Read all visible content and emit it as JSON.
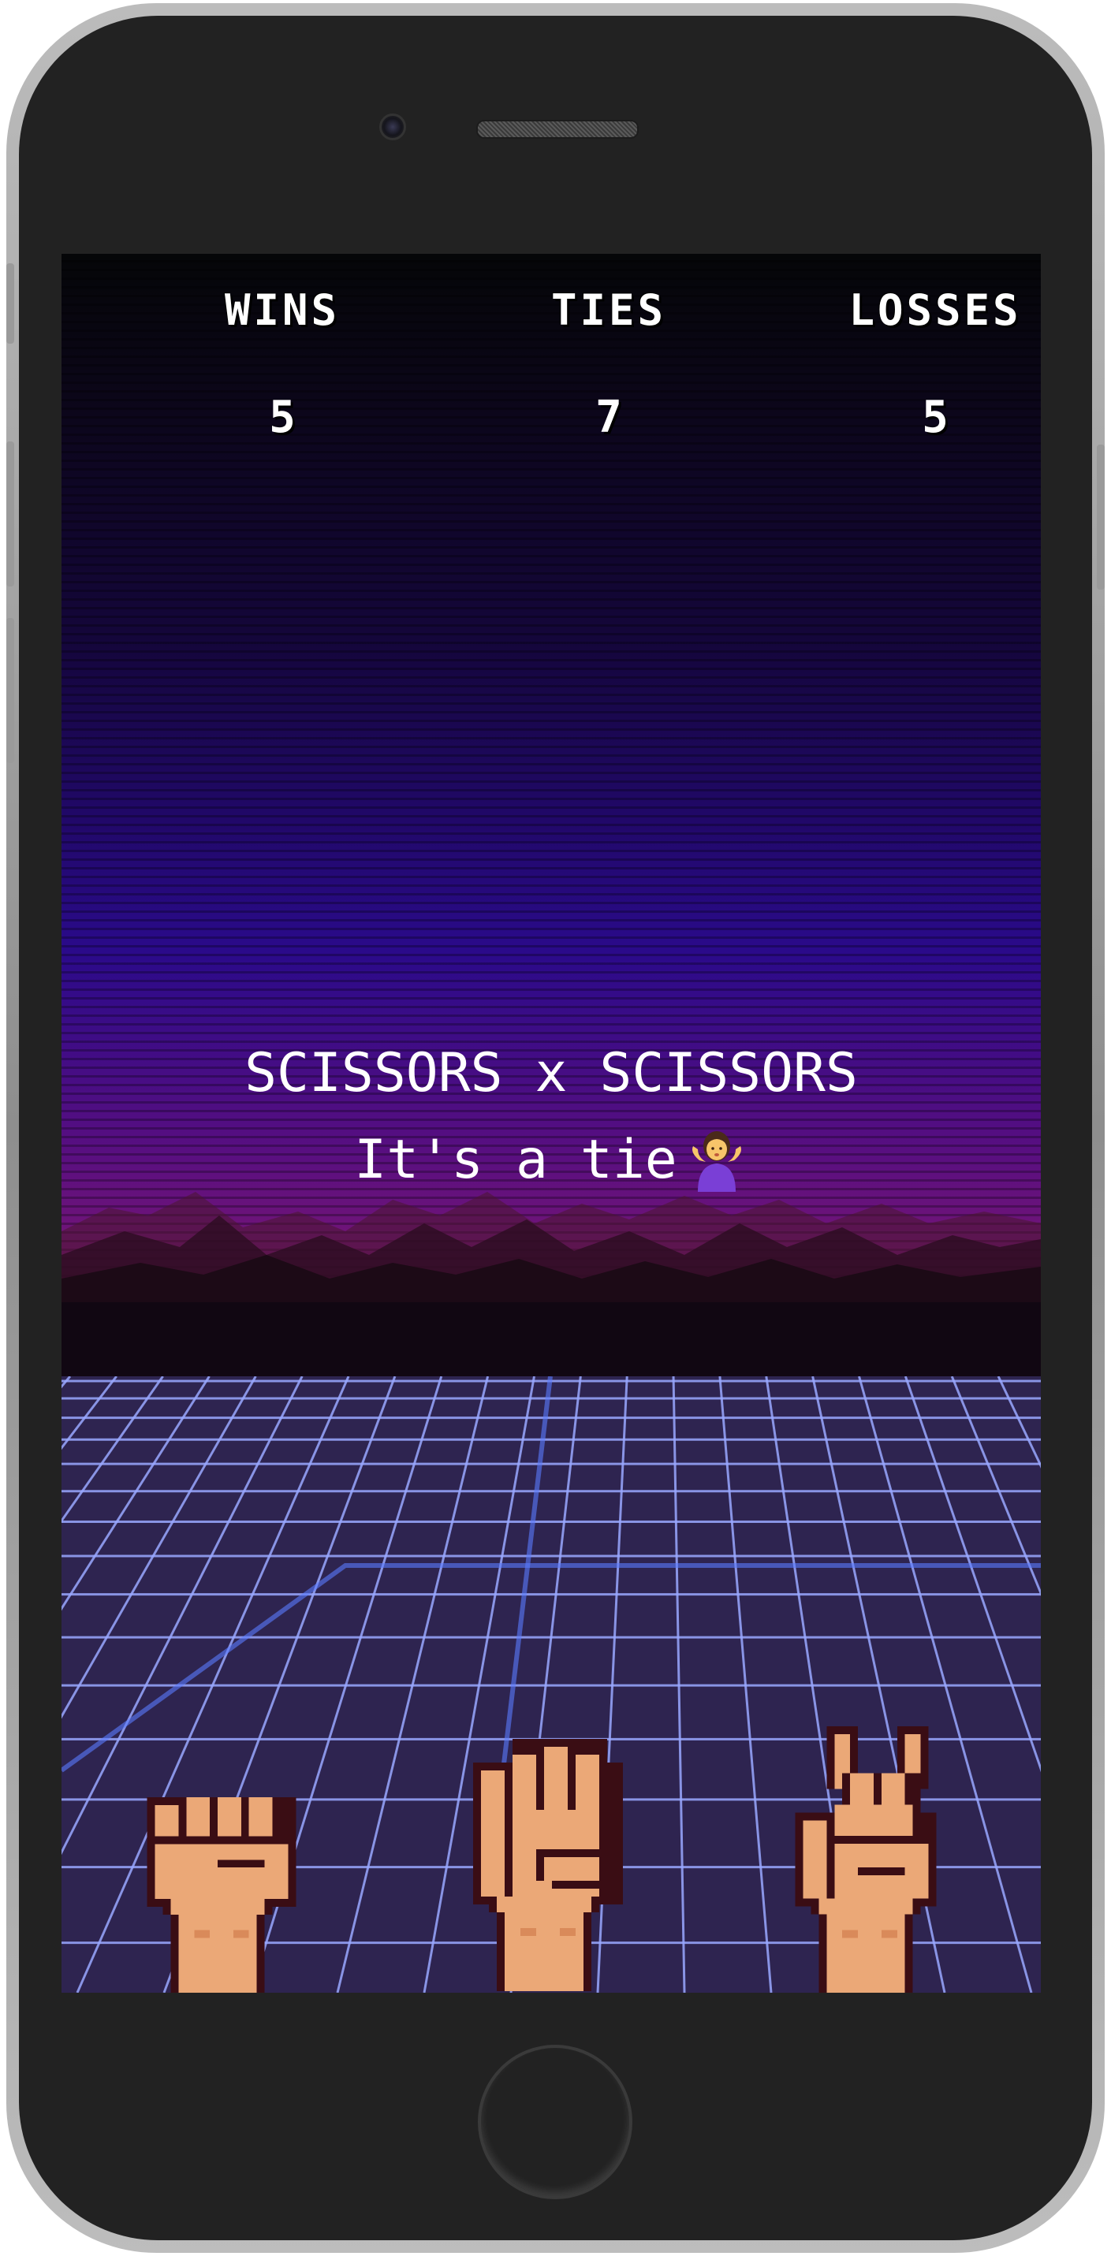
{
  "scoreboard": {
    "wins_label": "WINS",
    "ties_label": "TIES",
    "losses_label": "LOSSES",
    "wins": "5",
    "ties": "7",
    "losses": "5"
  },
  "result": {
    "matchup": "SCISSORS x SCISSORS",
    "message": "It's a tie",
    "emoji_icon": "person-shrugging-icon"
  },
  "choices": [
    {
      "name": "rock",
      "icon": "rock-hand-icon"
    },
    {
      "name": "paper",
      "icon": "paper-hand-icon"
    },
    {
      "name": "scissors",
      "icon": "scissors-hand-icon"
    }
  ],
  "colors": {
    "sky_top": "#0b0618",
    "sky_mid": "#2a0a8a",
    "sky_glow": "#a62468",
    "grid": "#9aa8ff",
    "skin": "#eba877",
    "outline": "#3a0d14"
  }
}
